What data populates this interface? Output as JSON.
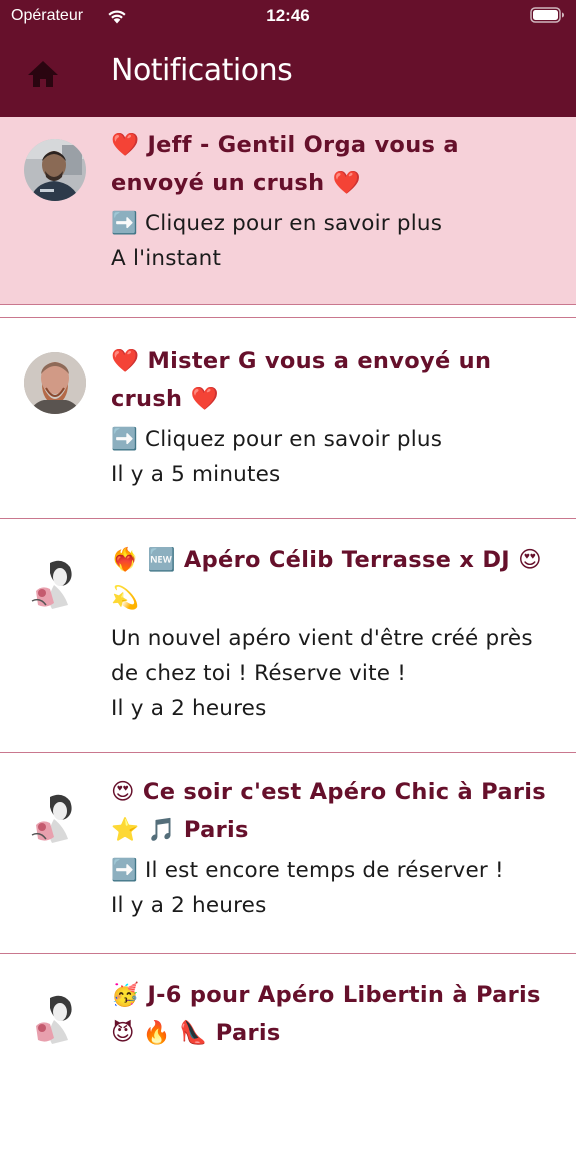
{
  "status_bar": {
    "carrier": "Opérateur",
    "time": "12:46",
    "wifi_icon": "wifi-icon",
    "battery_icon": "battery-icon"
  },
  "nav": {
    "home_icon": "home-icon",
    "title": "Notifications"
  },
  "colors": {
    "header": "#66102b",
    "unread_bg": "#f6d1d9",
    "title_text": "#66102b",
    "divider": "#c9778e"
  },
  "notifications": [
    {
      "avatar": "avatar-jeff",
      "title": "❤️  Jeff - Gentil Orga vous a envoyé un crush ❤️",
      "body": "➡️  Cliquez pour en savoir plus",
      "time": "A l'instant",
      "unread": true
    },
    {
      "avatar": "avatar-mister-g",
      "title": "❤️  Mister G vous a envoyé un crush ❤️",
      "body": "➡️  Cliquez pour en savoir plus",
      "time": "Il y a 5 minutes",
      "unread": false
    },
    {
      "avatar": "avatar-vintage-woman",
      "title": "❤️‍🔥 🆕  Apéro Célib Terrasse x DJ 😍 💫",
      "body": "Un nouvel apéro vient d'être créé près de chez toi ! Réserve vite !",
      "time": "Il y a 2 heures",
      "unread": false
    },
    {
      "avatar": "avatar-vintage-woman",
      "title": "😍 Ce soir c'est Apéro Chic à Paris ⭐ 🎵  Paris",
      "body": "➡️ Il est encore temps de réserver !",
      "time": "Il y a 2 heures",
      "unread": false
    },
    {
      "avatar": "avatar-vintage-woman",
      "title": "🥳 J-6 pour Apéro Libertin à Paris 😈 🔥 👠  Paris",
      "body": "",
      "time": "",
      "unread": false
    }
  ]
}
